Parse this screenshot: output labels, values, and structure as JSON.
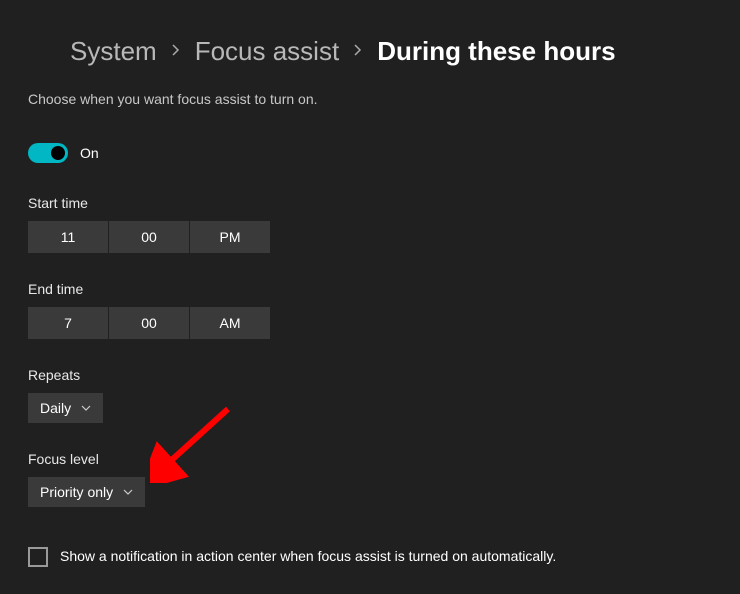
{
  "breadcrumb": {
    "system": "System",
    "focus_assist": "Focus assist",
    "current": "During these hours"
  },
  "description": "Choose when you want focus assist to turn on.",
  "toggle": {
    "label": "On"
  },
  "start_time": {
    "label": "Start time",
    "hour": "11",
    "minute": "00",
    "ampm": "PM"
  },
  "end_time": {
    "label": "End time",
    "hour": "7",
    "minute": "00",
    "ampm": "AM"
  },
  "repeats": {
    "label": "Repeats",
    "value": "Daily"
  },
  "focus_level": {
    "label": "Focus level",
    "value": "Priority only"
  },
  "notification_checkbox": {
    "text": "Show a notification in action center when focus assist is turned on automatically."
  }
}
